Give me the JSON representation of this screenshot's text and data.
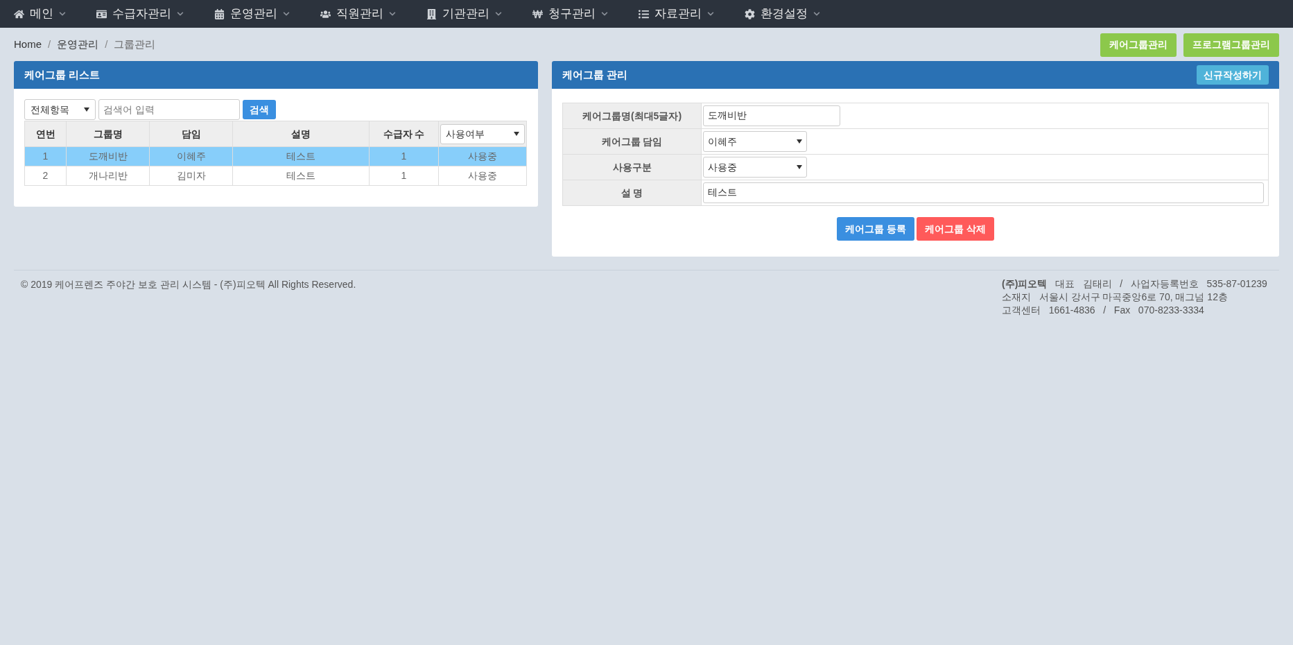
{
  "nav": [
    {
      "label": "메인"
    },
    {
      "label": "수급자관리"
    },
    {
      "label": "운영관리"
    },
    {
      "label": "직원관리"
    },
    {
      "label": "기관관리"
    },
    {
      "label": "청구관리"
    },
    {
      "label": "자료관리"
    },
    {
      "label": "환경설정"
    }
  ],
  "breadcrumb": [
    {
      "kind": "link",
      "text": "Home"
    },
    {
      "kind": "separator",
      "text": "/"
    },
    {
      "kind": "link",
      "text": "운영관리"
    },
    {
      "kind": "separator",
      "text": "/"
    },
    {
      "kind": "current",
      "text": "그룹관리"
    }
  ],
  "top_buttons": [
    "케어그룹관리",
    "프로그램그룹관리"
  ],
  "list_panel": {
    "title": "케어그룹 리스트",
    "filter_select": "전체항목",
    "search_placeholder": "검색어 입력",
    "search_button": "검색",
    "columns": [
      "연번",
      "그룹명",
      "담임",
      "설명",
      "수급자 수"
    ],
    "status_filter": "사용여부",
    "rows": [
      {
        "cells": [
          "1",
          "도깨비반",
          "이혜주",
          "테스트",
          "1",
          "사용중"
        ],
        "selected": true
      },
      {
        "cells": [
          "2",
          "개나리반",
          "김미자",
          "테스트",
          "1",
          "사용중"
        ],
        "selected": false
      }
    ]
  },
  "edit_panel": {
    "title": "케어그룹 관리",
    "new_button": "신규작성하기",
    "fields": [
      {
        "kind": "input",
        "label": "케어그룹명(최대5글자)",
        "value": "도깨비반"
      },
      {
        "kind": "select",
        "label": "케어그룹 담임",
        "value": "이혜주"
      },
      {
        "kind": "select",
        "label": "사용구분",
        "value": "사용중"
      },
      {
        "kind": "wide",
        "label": "설 명",
        "value": "테스트"
      }
    ],
    "save_button": "케어그룹 등록",
    "delete_button": "케어그룹 삭제"
  },
  "footer": {
    "copyright": "© 2019 케어프렌즈 주야간 보호 관리 시스템 - (주)피오텍 All Rights Reserved.",
    "info_lines": [
      "**(주)피오텍**   대표   김태리   /   사업자등록번호   535-87-01239",
      "소재지   서울시 강서구 마곡중앙6로 70, 매그넘 12층",
      "고객센터   1661-4836   /   Fax   070-8233-3334"
    ]
  }
}
